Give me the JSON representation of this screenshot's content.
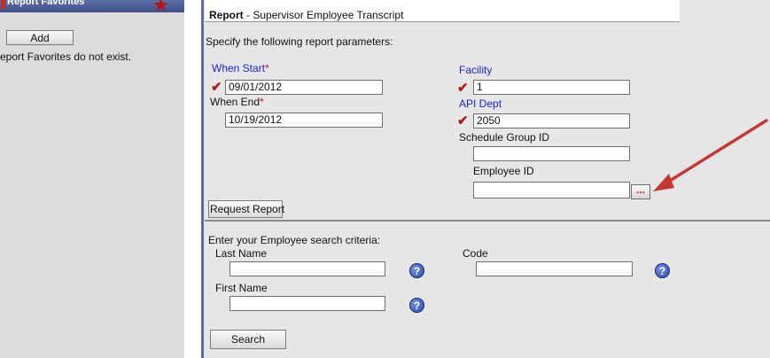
{
  "favorites": {
    "title": "Report Favorites",
    "add_label": "Add",
    "empty_text": "eport Favorites do not exist."
  },
  "report": {
    "title_prefix": "Report",
    "title_suffix": " - Supervisor Employee Transcript",
    "instructions": "Specify the following report parameters:",
    "when_start": {
      "label": "When Start",
      "required_mark": "*",
      "value": "09/01/2012"
    },
    "when_end": {
      "label": "When End",
      "required_mark": "*",
      "value": "10/19/2012"
    },
    "facility": {
      "label": "Facility",
      "value": "1"
    },
    "api_dept": {
      "label": "API Dept",
      "value": "2050"
    },
    "schedule_group": {
      "label": "Schedule Group ID",
      "value": ""
    },
    "employee_id": {
      "label": "Employee ID",
      "value": "",
      "lookup_glyph": "..."
    },
    "request_button": "Request Report"
  },
  "search": {
    "instructions": "Enter your Employee search criteria:",
    "last_name": {
      "label": "Last Name",
      "value": ""
    },
    "first_name": {
      "label": "First Name",
      "value": ""
    },
    "code": {
      "label": "Code",
      "value": ""
    },
    "help_glyph": "?",
    "button": "Search"
  },
  "icons": {
    "check": "checkmark-icon",
    "help": "help-icon",
    "star": "star-icon",
    "arrow": "red-arrow-annotation"
  },
  "colors": {
    "blue_label": "#1c22d8",
    "required": "#d21010",
    "panel_bg": "#e6e6e6",
    "header_bg": "#3f4f8c"
  }
}
